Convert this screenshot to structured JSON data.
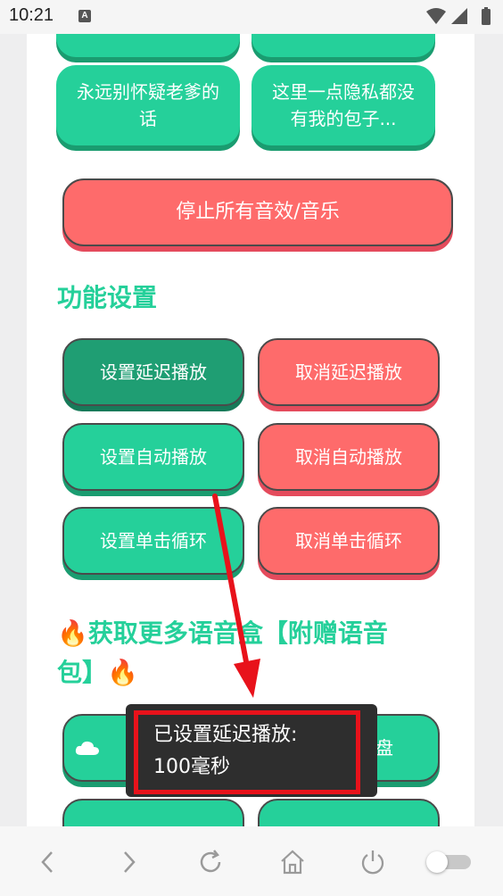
{
  "status_bar": {
    "time": "10:21",
    "notification_letter": "A"
  },
  "sound_buttons_top": [
    {
      "label": ""
    },
    {
      "label": ""
    }
  ],
  "sound_buttons": [
    {
      "label": "永远别怀疑老爹的话"
    },
    {
      "label": "这里一点隐私都没有我的包子..."
    }
  ],
  "stop_all_button": {
    "label": "停止所有音效/音乐"
  },
  "settings_section": {
    "title": "功能设置",
    "buttons": [
      {
        "label": "设置延迟播放"
      },
      {
        "label": "取消延迟播放"
      },
      {
        "label": "设置自动播放"
      },
      {
        "label": "取消自动播放"
      },
      {
        "label": "设置单击循环"
      },
      {
        "label": "取消单击循环"
      }
    ]
  },
  "more_section": {
    "title_line1": "🔥获取更多语音盒【附赠语音",
    "title_line2": "包】🔥"
  },
  "bottom_buttons": [
    {
      "label": ""
    },
    {
      "label": "盘"
    },
    {
      "label": ""
    },
    {
      "label": ""
    }
  ],
  "toast": {
    "message_line1": "已设置延迟播放:",
    "message_line2": "100毫秒"
  },
  "colors": {
    "accent_green": "#25d09a",
    "accent_red": "#fe6b6b",
    "highlight_red": "#e8121b"
  }
}
